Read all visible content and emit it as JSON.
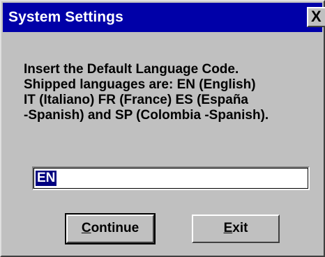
{
  "dialog": {
    "title": "System Settings",
    "close_glyph": "X",
    "message_lines": [
      "Insert the Default Language Code.",
      "Shipped languages are: EN (English)",
      "IT (Italiano) FR (France) ES (España",
      "-Spanish) and SP (Colombia -Spanish)."
    ],
    "input": {
      "value": "EN"
    },
    "buttons": {
      "continue_label": "Continue",
      "exit_label": "Exit"
    }
  },
  "colors": {
    "titlebar": "#0000a8",
    "face": "#c0c0c0",
    "selection": "#000080"
  }
}
